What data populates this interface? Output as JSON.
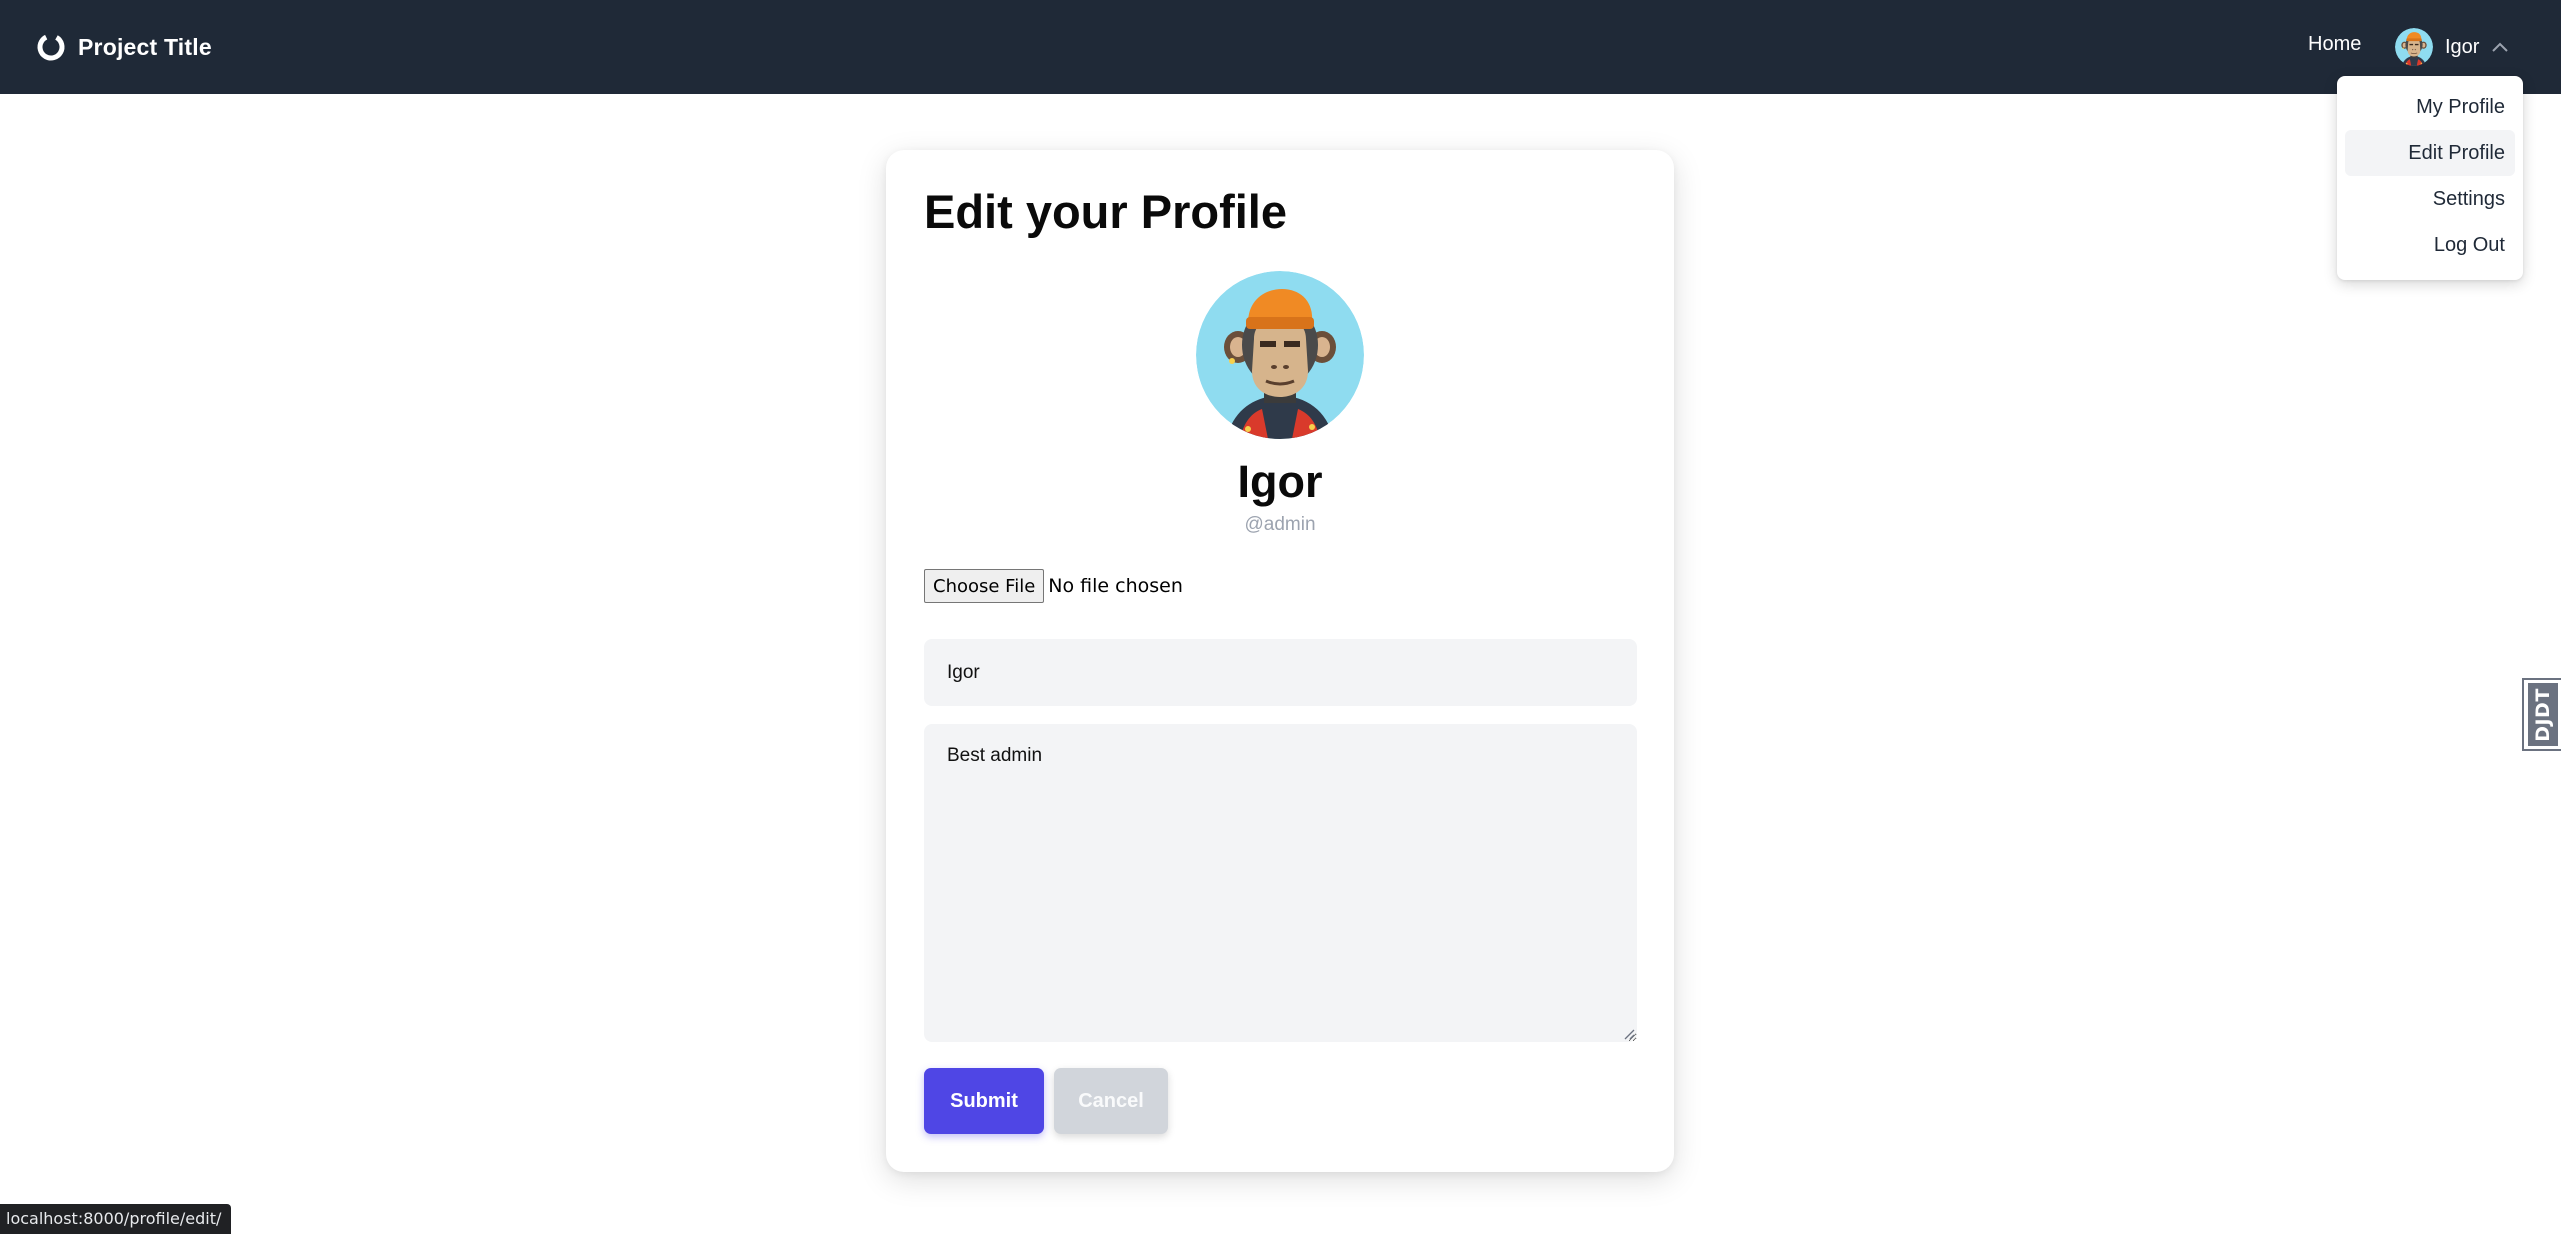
{
  "header": {
    "brand_title": "Project Title",
    "nav_home": "Home",
    "user_name": "Igor"
  },
  "dropdown": {
    "items": [
      {
        "label": "My Profile",
        "active": false
      },
      {
        "label": "Edit Profile",
        "active": true
      },
      {
        "label": "Settings",
        "active": false
      },
      {
        "label": "Log Out",
        "active": false
      }
    ]
  },
  "profile_form": {
    "title": "Edit your Profile",
    "display_name": "Igor",
    "handle": "@admin",
    "choose_file_label": "Choose File",
    "file_status": "No file chosen",
    "name_value": "Igor",
    "bio_value": "Best admin",
    "submit_label": "Submit",
    "cancel_label": "Cancel"
  },
  "debug_toolbar": {
    "handle_label": "DJDT"
  },
  "status_bar": {
    "url": "localhost:8000/profile/edit/"
  },
  "colors": {
    "header_bg": "#1f2937",
    "accent": "#4f46e5",
    "cancel_bg": "#d1d5db",
    "input_bg": "#f3f4f6"
  },
  "icons": {
    "brand": "ring-logo-icon",
    "avatar": "ape-avatar-icon",
    "chevron": "chevron-up-icon"
  }
}
